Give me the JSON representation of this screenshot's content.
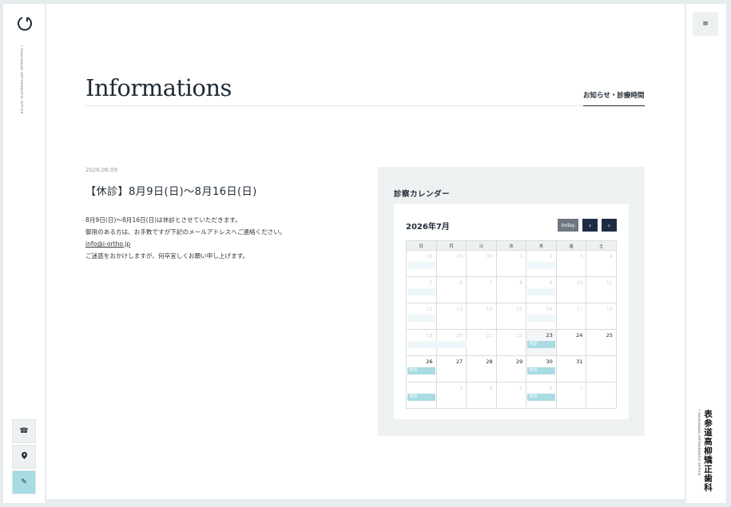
{
  "brand": {
    "logo_text": "I.TAKAYANAGI ORTHODONTIC OFFICE",
    "name_jp": "表参道高柳矯正歯科",
    "name_en": "I.TAKAYANAGI ORTHODONTIC OFFICE"
  },
  "icons": {
    "phone": "☎",
    "map": "⬤",
    "pen": "✎",
    "menu": "≡"
  },
  "page": {
    "title": "Informations",
    "subtitle": "お知らせ・診療時間"
  },
  "post": {
    "date": "2026.06.09",
    "title": "【休診】8月9日(日)〜8月16日(日)",
    "body": [
      "8月9日(日)〜8月16日(日)は休診とさせていただきます。",
      "御用のある方は、お手数ですが下記のメールアドレスへご連絡ください。",
      "info@i-ortho.jp",
      "ご迷惑をおかけしますが、何卒宜しくお願い申し上げます。"
    ]
  },
  "calendar": {
    "heading": "診察カレンダー",
    "month": "2026年7月",
    "today_label": "today",
    "prev": "‹",
    "next": "›",
    "weekdays": [
      "日",
      "月",
      "火",
      "水",
      "木",
      "金",
      "土"
    ],
    "event_label": "休診",
    "weeks": [
      [
        "28",
        "29",
        "30",
        "1",
        "2",
        "3",
        "4"
      ],
      [
        "5",
        "6",
        "7",
        "8",
        "9",
        "10",
        "11"
      ],
      [
        "12",
        "13",
        "14",
        "15",
        "16",
        "17",
        "18"
      ],
      [
        "19",
        "20",
        "21",
        "22",
        "23",
        "24",
        "25"
      ],
      [
        "26",
        "27",
        "28",
        "29",
        "30",
        "31",
        ""
      ],
      [
        "",
        "3",
        "4",
        "5",
        "6",
        "7",
        ""
      ]
    ]
  },
  "colors": {
    "accent": "#a8dbe2",
    "navy": "#1f2d44",
    "panel": "#eef1f2"
  }
}
